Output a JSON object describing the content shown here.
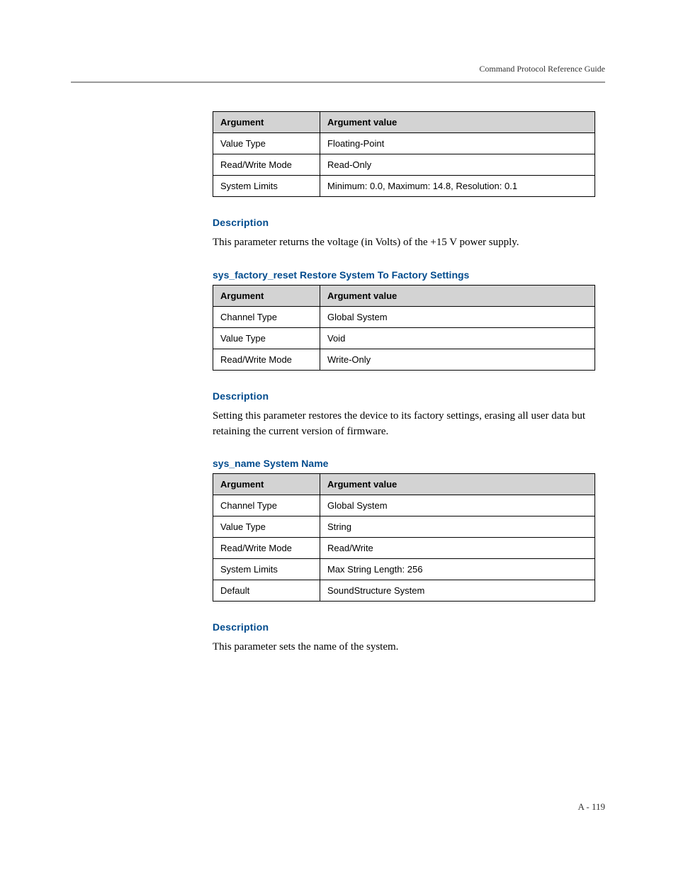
{
  "header": {
    "title": "Command Protocol Reference Guide"
  },
  "table1": {
    "head": {
      "col1": "Argument",
      "col2": "Argument value"
    },
    "rows": [
      {
        "label": "Value Type",
        "value": "Floating-Point"
      },
      {
        "label": "Read/Write Mode",
        "value": "Read-Only"
      },
      {
        "label": "System Limits",
        "value": "Minimum: 0.0, Maximum: 14.8, Resolution: 0.1"
      }
    ]
  },
  "desc1": {
    "heading": "Description",
    "text": "This parameter returns the voltage (in Volts) of the +15 V power supply."
  },
  "section2": {
    "heading": "sys_factory_reset Restore System To Factory Settings"
  },
  "table2": {
    "head": {
      "col1": "Argument",
      "col2": "Argument value"
    },
    "rows": [
      {
        "label": "Channel Type",
        "value": "Global System"
      },
      {
        "label": "Value Type",
        "value": "Void"
      },
      {
        "label": "Read/Write Mode",
        "value": "Write-Only"
      }
    ]
  },
  "desc2": {
    "heading": "Description",
    "text": "Setting this parameter restores the device to its factory settings, erasing all user data but retaining the current version of firmware."
  },
  "section3": {
    "heading": "sys_name System Name"
  },
  "table3": {
    "head": {
      "col1": "Argument",
      "col2": "Argument value"
    },
    "rows": [
      {
        "label": "Channel Type",
        "value": "Global System"
      },
      {
        "label": "Value Type",
        "value": "String"
      },
      {
        "label": "Read/Write Mode",
        "value": "Read/Write"
      },
      {
        "label": "System Limits",
        "value": "Max String Length: 256"
      },
      {
        "label": "Default",
        "value": "SoundStructure System"
      }
    ]
  },
  "desc3": {
    "heading": "Description",
    "text": "This parameter sets the name of the system."
  },
  "footer": {
    "page": "A - 119"
  }
}
